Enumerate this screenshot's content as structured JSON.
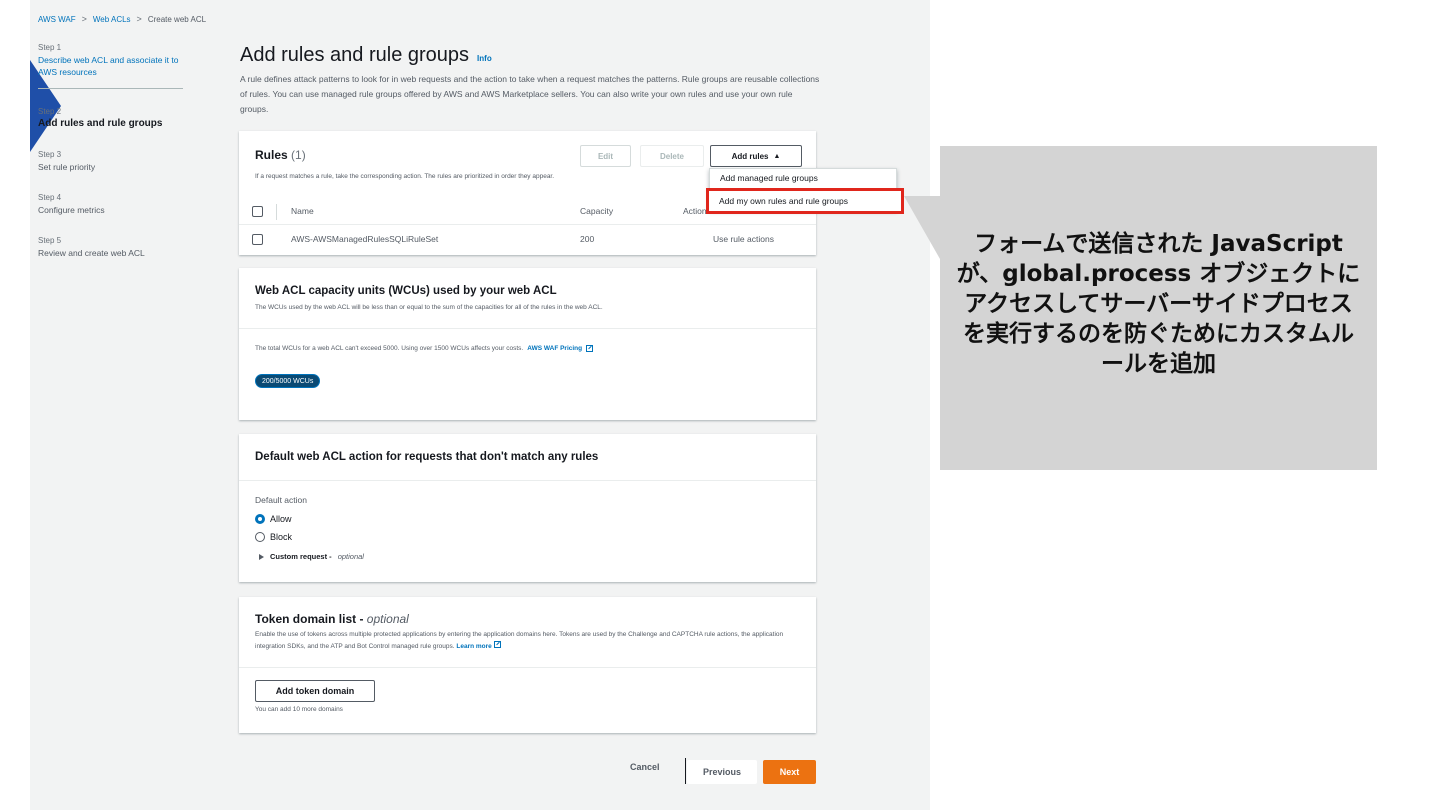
{
  "breadcrumb": [
    "AWS WAF",
    "Web ACLs",
    "Create web ACL"
  ],
  "steps": [
    {
      "num": "Step 1",
      "label": "Describe web ACL and associate it to AWS resources"
    },
    {
      "num": "Step 2",
      "label": "Add rules and rule groups"
    },
    {
      "num": "Step 3",
      "label": "Set rule priority"
    },
    {
      "num": "Step 4",
      "label": "Configure metrics"
    },
    {
      "num": "Step 5",
      "label": "Review and create web ACL"
    }
  ],
  "page": {
    "title": "Add rules and rule groups",
    "info": "Info",
    "description": "A rule defines attack patterns to look for in web requests and the action to take when a request matches the patterns. Rule groups are reusable collections of rules. You can use managed rule groups offered by AWS and AWS Marketplace sellers. You can also write your own rules and use your own rule groups."
  },
  "rules": {
    "title": "Rules",
    "count": "(1)",
    "subtitle": "If a request matches a rule, take the corresponding action. The rules are prioritized in order they appear.",
    "edit": "Edit",
    "delete": "Delete",
    "add_rules": "Add rules",
    "add_rules_caret": "▲",
    "columns": {
      "name": "Name",
      "capacity": "Capacity",
      "action": "Action"
    },
    "rows": [
      {
        "name": "AWS-AWSManagedRulesSQLiRuleSet",
        "capacity": "200",
        "action": "Use rule actions"
      }
    ],
    "menu": {
      "managed": "Add managed rule groups",
      "own": "Add my own rules and rule groups"
    }
  },
  "wcu": {
    "title": "Web ACL capacity units (WCUs) used by your web ACL",
    "subtitle": "The WCUs used by the web ACL will be less than or equal to the sum of the capacities for all of the rules in the web ACL.",
    "text": "The total WCUs for a web ACL can't exceed 5000. Using over 1500 WCUs affects your costs.",
    "pricing_link": "AWS WAF Pricing",
    "badge": "200/5000 WCUs"
  },
  "default_action": {
    "title": "Default web ACL action for requests that don't match any rules",
    "label": "Default action",
    "allow": "Allow",
    "block": "Block",
    "custom_bold": "Custom request -",
    "custom_italic": "optional"
  },
  "token": {
    "title": "Token domain list -",
    "title_optional": "optional",
    "description": "Enable the use of tokens across multiple protected applications by entering the application domains here. Tokens are used by the Challenge and CAPTCHA rule actions, the application integration SDKs, and the ATP and Bot Control managed rule groups.",
    "learn_more": "Learn more",
    "add_button": "Add token domain",
    "note": "You can add 10 more domains"
  },
  "footer": {
    "cancel": "Cancel",
    "previous": "Previous",
    "next": "Next"
  },
  "callout": {
    "text": "フォームで送信された JavaScript が、global.process オブジェクトにアクセスしてサーバーサイドプロセスを実行するのを防ぐためにカスタムルールを追加"
  },
  "colors": {
    "accent_blue": "#0073bb",
    "next_orange": "#ec7211",
    "highlight_red": "#e0261c",
    "callout_gray": "#d4d4d4"
  }
}
